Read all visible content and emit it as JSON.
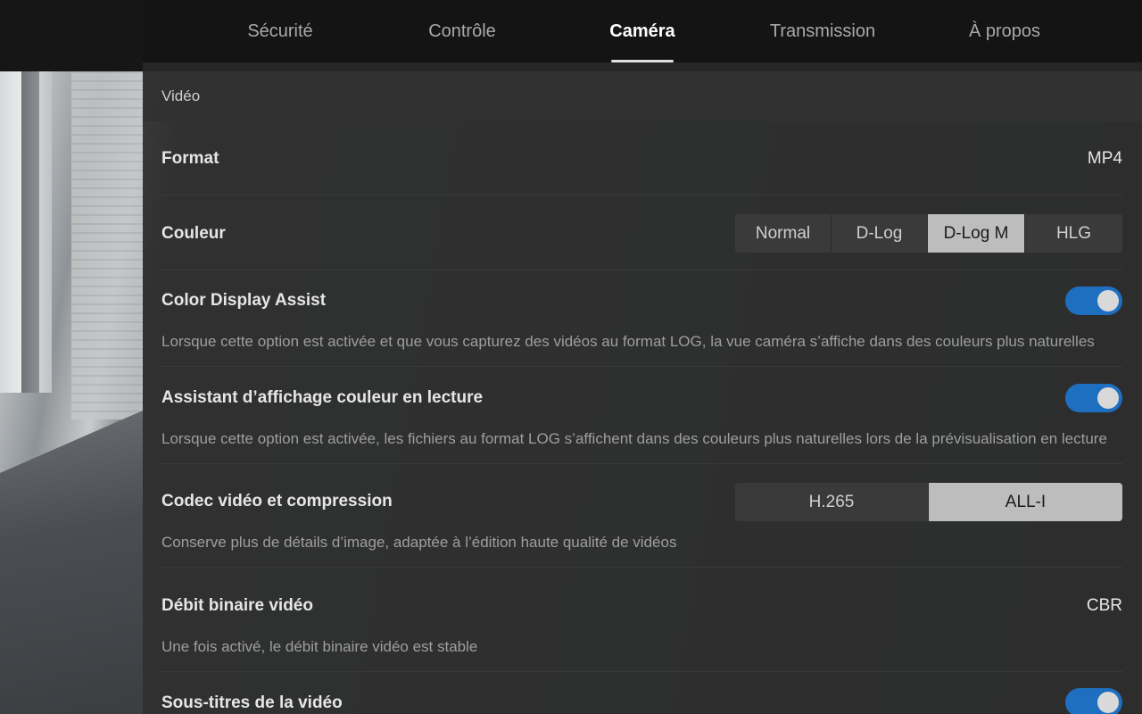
{
  "tabs": [
    {
      "label": "Sécurité",
      "active": false
    },
    {
      "label": "Contrôle",
      "active": false
    },
    {
      "label": "Caméra",
      "active": true
    },
    {
      "label": "Transmission",
      "active": false
    },
    {
      "label": "À propos",
      "active": false
    }
  ],
  "section": {
    "title": "Vidéo"
  },
  "settings": {
    "format": {
      "title": "Format",
      "value": "MP4"
    },
    "couleur": {
      "title": "Couleur",
      "options": [
        "Normal",
        "D-Log",
        "D-Log M",
        "HLG"
      ],
      "selected": "D-Log M"
    },
    "color_display_assist": {
      "title": "Color Display Assist",
      "description": "Lorsque cette option est activée et que vous capturez des vidéos au format LOG, la vue caméra s’affiche dans des couleurs plus naturelles",
      "enabled": true
    },
    "playback_assist": {
      "title": "Assistant d’affichage couleur en lecture",
      "description": "Lorsque cette option est activée, les fichiers au format LOG s’affichent dans des couleurs plus naturelles lors de la prévisualisation en lecture",
      "enabled": true
    },
    "codec": {
      "title": "Codec vidéo et compression",
      "description": "Conserve plus de détails d’image, adaptée à l’édition haute qualité de vidéos",
      "options": [
        "H.265",
        "ALL-I"
      ],
      "selected": "ALL-I"
    },
    "bitrate": {
      "title": "Débit binaire vidéo",
      "description": "Une fois activé, le débit binaire vidéo est stable",
      "value": "CBR"
    },
    "subtitles": {
      "title": "Sous-titres de la vidéo",
      "enabled": true
    }
  },
  "colors": {
    "toggle_on": "#1f6fc1",
    "segment_selected": "#bdbdbd"
  }
}
